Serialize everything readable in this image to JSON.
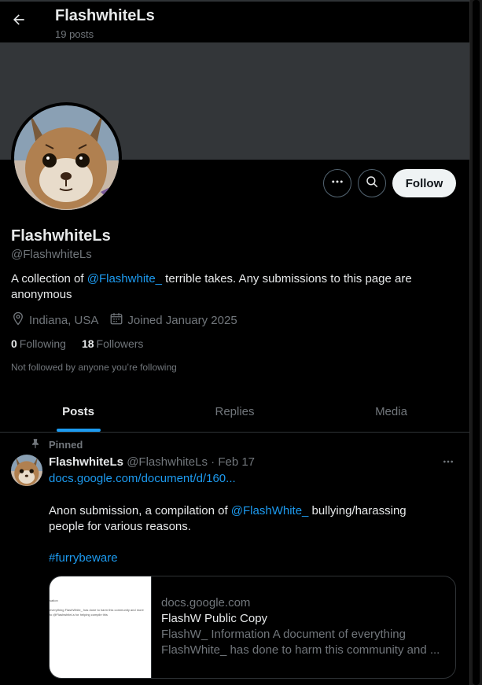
{
  "header": {
    "title": "FlashwhiteLs",
    "post_count": "19 posts"
  },
  "profile": {
    "display_name": "FlashwhiteLs",
    "handle": "@FlashwhiteLs",
    "bio_prefix": "A collection of ",
    "bio_mention": "@Flashwhite_",
    "bio_suffix": " terrible takes. Any submissions to this page are anonymous",
    "location": "Indiana, USA",
    "joined": "Joined January 2025",
    "following_count": "0",
    "following_label": "Following",
    "followers_count": "18",
    "followers_label": "Followers",
    "not_followed_text": "Not followed by anyone you’re following",
    "follow_label": "Follow"
  },
  "icons": {
    "back": "arrow-left-icon",
    "more": "more-horizontal-icon",
    "search": "search-icon",
    "location": "location-pin-icon",
    "calendar": "calendar-icon",
    "pin": "pin-icon"
  },
  "tabs": [
    {
      "label": "Posts",
      "active": true
    },
    {
      "label": "Replies",
      "active": false
    },
    {
      "label": "Media",
      "active": false
    }
  ],
  "post": {
    "pinned_label": "Pinned",
    "author_name": "FlashwhiteLs",
    "author_handle": "@FlashwhiteLs",
    "separator": "·",
    "date": "Feb 17",
    "link": "docs.google.com/document/d/160...",
    "text_prefix": "Anon submission, a compilation of ",
    "text_mention": "@FlashWhite_",
    "text_suffix": "  bullying/harassing people for various reasons.",
    "hashtag": "#furrybeware",
    "card": {
      "domain": "docs.google.com",
      "title": "FlashW Public Copy",
      "description": "FlashW_ Information A document of everything FlashWhite_ has done to harm this community and ...",
      "thumb_line1": "sation",
      "thumb_line2": "everything FlashWhite_ has done to harm this community and more",
      "thumb_line3": "to @FlashwhiteLs for helping compile this"
    }
  },
  "colors": {
    "background": "#000000",
    "banner": "#333639",
    "accent": "#1d9bf0",
    "text_primary": "#e7e9ea",
    "text_secondary": "#71767b",
    "border": "#2f3336",
    "follow_button_bg": "#eff3f4"
  }
}
